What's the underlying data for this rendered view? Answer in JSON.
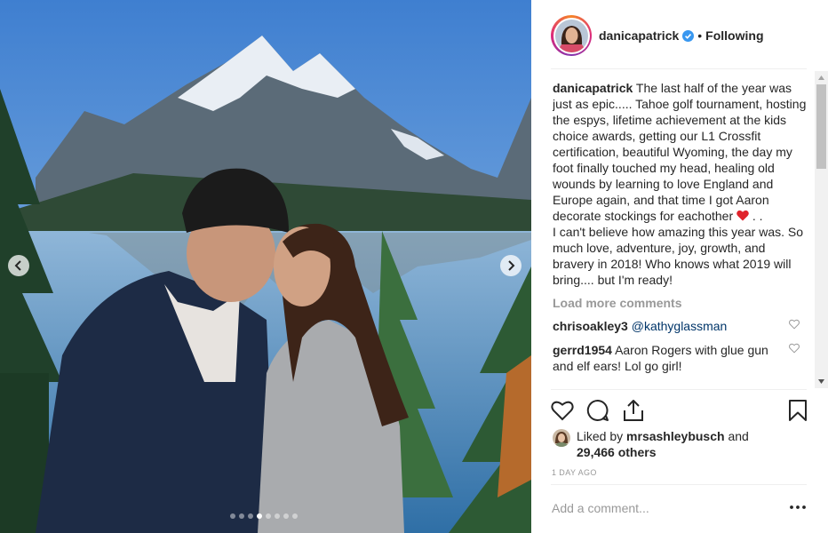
{
  "post": {
    "username": "danicapatrick",
    "follow_separator": "•",
    "follow_label": "Following",
    "carousel": {
      "slide_count": 8,
      "active_slide": 4
    }
  },
  "caption": {
    "username": "danicapatrick",
    "text_before_emoji": "The last half of the year was just as epic..... Tahoe golf tournament, hosting the espys, lifetime achievement at the kids choice awards, getting our L1 Crossfit certification, beautiful Wyoming, the day my foot finally touched my head, healing old wounds by learning to love England and Europe again, and that time I got Aaron decorate stockings for eachother",
    "emoji": "red-heart",
    "text_after_emoji": " . .",
    "text_second_paragraph": "I can't believe how amazing this year was. So much love, adventure, joy, growth, and bravery in 2018! Who knows what 2019 will bring.... but I'm ready!"
  },
  "load_more": "Load more comments",
  "comments": [
    {
      "username": "chrisoakley3",
      "mention": "@kathyglassman",
      "text": ""
    },
    {
      "username": "gerrd1954",
      "mention": "",
      "text": "Aaron Rogers with glue gun and elf ears! Lol go girl!"
    }
  ],
  "likes": {
    "prefix": "Liked by",
    "user": "mrsashleybusch",
    "joiner": "and",
    "count_text": "29,466 others"
  },
  "time_ago": "1 DAY AGO",
  "add_comment": {
    "placeholder": "Add a comment..."
  },
  "icons": {
    "like": "heart-icon",
    "comment": "comment-bubble-icon",
    "share": "share-icon",
    "save": "bookmark-icon",
    "verified": "verified-badge-icon",
    "more": "more-options-icon"
  },
  "colors": {
    "verified": "#3897f0",
    "mention": "#003569",
    "muted": "#999999",
    "heart": "#ed4956"
  }
}
